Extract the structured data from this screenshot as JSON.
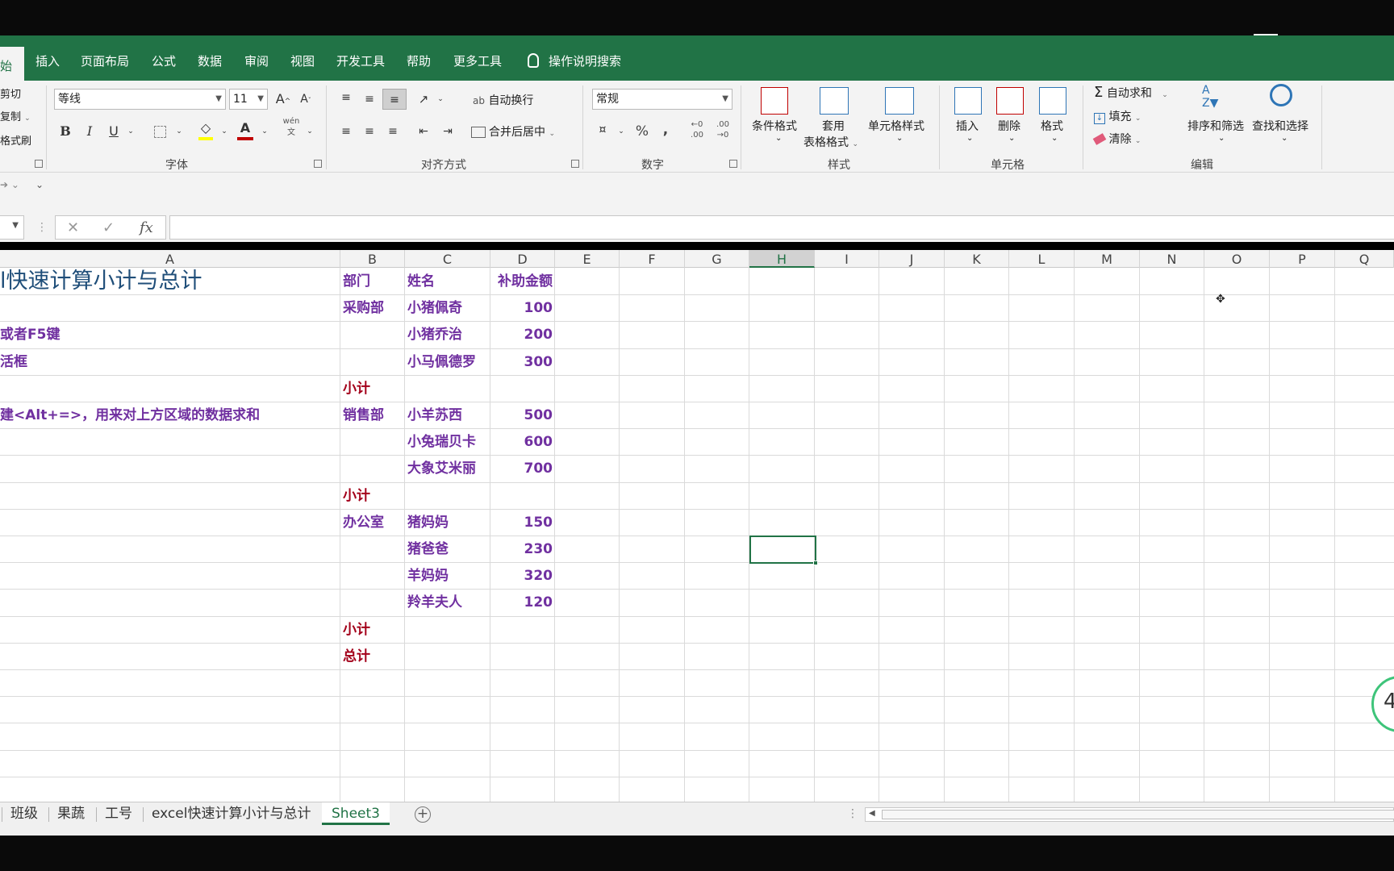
{
  "ribbon_tabs": [
    {
      "label": "始",
      "active": true
    },
    {
      "label": "插入"
    },
    {
      "label": "页面布局"
    },
    {
      "label": "公式"
    },
    {
      "label": "数据"
    },
    {
      "label": "审阅"
    },
    {
      "label": "视图"
    },
    {
      "label": "开发工具"
    },
    {
      "label": "帮助"
    },
    {
      "label": "更多工具"
    }
  ],
  "tell_me": "操作说明搜索",
  "clipboard": {
    "cut": "剪切",
    "copy": "复制",
    "painter": "格式刷"
  },
  "font": {
    "name": "等线",
    "size": "11",
    "bold": "B",
    "italic": "I",
    "underline": "U",
    "phonetic": "wén",
    "group_label": "字体"
  },
  "alignment": {
    "wrap": "自动换行",
    "merge": "合并后居中",
    "group_label": "对齐方式"
  },
  "number": {
    "format": "常规",
    "percent": "%",
    "comma": ",",
    "group_label": "数字"
  },
  "styles": {
    "conditional": "条件格式",
    "table_line1": "套用",
    "table_line2": "表格格式",
    "cell_styles": "单元格样式",
    "group_label": "样式"
  },
  "cells": {
    "insert": "插入",
    "delete": "删除",
    "format": "格式",
    "group_label": "单元格"
  },
  "editing": {
    "autosum": "自动求和",
    "fill": "填充",
    "clear": "清除",
    "sort_filter": "排序和筛选",
    "find_select": "查找和选择",
    "group_label": "编辑"
  },
  "formula_bar": {
    "fx": "fx",
    "value": ""
  },
  "columns": [
    "A",
    "B",
    "C",
    "D",
    "E",
    "F",
    "G",
    "H",
    "I",
    "J",
    "K",
    "L",
    "M",
    "N",
    "O",
    "P",
    "Q"
  ],
  "selected_column": "H",
  "sheet": {
    "title": "l快速计算小计与总计",
    "notes": [
      {
        "row": 3,
        "text": "或者F5键"
      },
      {
        "row": 4,
        "text": "活框"
      },
      {
        "row": 6,
        "text": "建<Alt+=>，用来对上方区域的数据求和"
      }
    ],
    "header": {
      "dept": "部门",
      "name": "姓名",
      "amount": "补助金额"
    },
    "rows": [
      {
        "dept": "采购部",
        "name": "小猪佩奇",
        "amount": "100"
      },
      {
        "dept": "",
        "name": "小猪乔治",
        "amount": "200"
      },
      {
        "dept": "",
        "name": "小马佩德罗",
        "amount": "300"
      },
      {
        "dept": "小计",
        "name": "",
        "amount": "",
        "subtotal": true
      },
      {
        "dept": "销售部",
        "name": "小羊苏西",
        "amount": "500"
      },
      {
        "dept": "",
        "name": "小兔瑞贝卡",
        "amount": "600"
      },
      {
        "dept": "",
        "name": "大象艾米丽",
        "amount": "700"
      },
      {
        "dept": "小计",
        "name": "",
        "amount": "",
        "subtotal": true
      },
      {
        "dept": "办公室",
        "name": "猪妈妈",
        "amount": "150"
      },
      {
        "dept": "",
        "name": "猪爸爸",
        "amount": "230"
      },
      {
        "dept": "",
        "name": "羊妈妈",
        "amount": "320"
      },
      {
        "dept": "",
        "name": "羚羊夫人",
        "amount": "120"
      },
      {
        "dept": "小计",
        "name": "",
        "amount": "",
        "subtotal": true
      },
      {
        "dept": "总计",
        "name": "",
        "amount": "",
        "subtotal": true
      }
    ]
  },
  "sheet_tabs": [
    {
      "label": "班级"
    },
    {
      "label": "果蔬"
    },
    {
      "label": "工号"
    },
    {
      "label": "excel快速计算小计与总计"
    },
    {
      "label": "Sheet3",
      "active": true
    }
  ],
  "add_sheet": "+",
  "bubble_text": "4",
  "colors": {
    "accent": "#217346",
    "data_text": "#7030a0",
    "subtotal_text": "#a3001a",
    "title_text": "#1f4e79"
  }
}
